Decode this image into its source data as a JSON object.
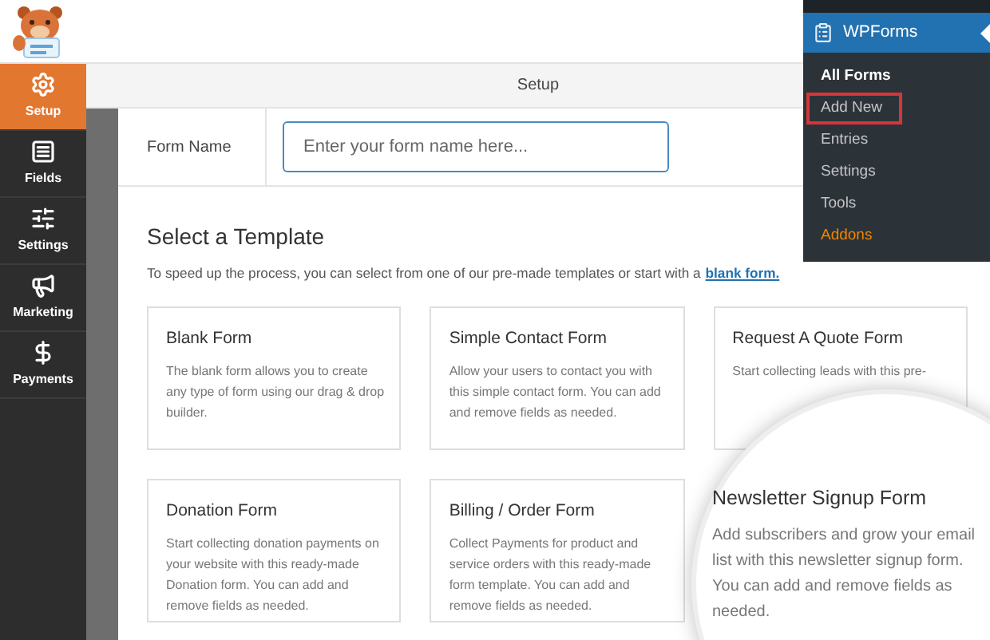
{
  "sidebar": {
    "items": [
      {
        "label": "Setup",
        "selected": true
      },
      {
        "label": "Fields",
        "selected": false
      },
      {
        "label": "Settings",
        "selected": false
      },
      {
        "label": "Marketing",
        "selected": false
      },
      {
        "label": "Payments",
        "selected": false
      }
    ]
  },
  "toolbar": {
    "title": "Setup"
  },
  "form_name": {
    "label": "Form Name",
    "placeholder": "Enter your form name here..."
  },
  "templates": {
    "heading": "Select a Template",
    "intro": "To speed up the process, you can select from one of our pre-made templates or start with a",
    "intro_link": "blank form.",
    "cards": [
      {
        "title": "Blank Form",
        "description": "The blank form allows you to create any type of form using our drag & drop builder."
      },
      {
        "title": "Simple Contact Form",
        "description": "Allow your users to contact you with this simple contact form. You can add and remove fields as needed."
      },
      {
        "title": "Request A Quote Form",
        "description": "Start collecting leads with this pre-"
      },
      {
        "title": "Donation Form",
        "description": "Start collecting donation payments on your website with this ready-made Donation form. You can add and remove fields as needed."
      },
      {
        "title": "Billing / Order Form",
        "description": "Collect Payments for product and service orders with this ready-made form template. You can add and remove fields as needed."
      }
    ]
  },
  "magnifier": {
    "title": "Newsletter Signup Form",
    "description": "Add subscribers and grow your email list with this newsletter signup form. You can add and remove fields as needed."
  },
  "admin_menu": {
    "title": "WPForms",
    "items": [
      {
        "label": "All Forms",
        "selected": true,
        "outlined": false,
        "kind": "page"
      },
      {
        "label": "Add New",
        "selected": false,
        "outlined": true,
        "kind": "page"
      },
      {
        "label": "Entries",
        "selected": false,
        "outlined": false,
        "kind": "page"
      },
      {
        "label": "Settings",
        "selected": false,
        "outlined": false,
        "kind": "page"
      },
      {
        "label": "Tools",
        "selected": false,
        "outlined": false,
        "kind": "page"
      },
      {
        "label": "Addons",
        "selected": false,
        "outlined": false,
        "kind": "addon"
      }
    ]
  }
}
